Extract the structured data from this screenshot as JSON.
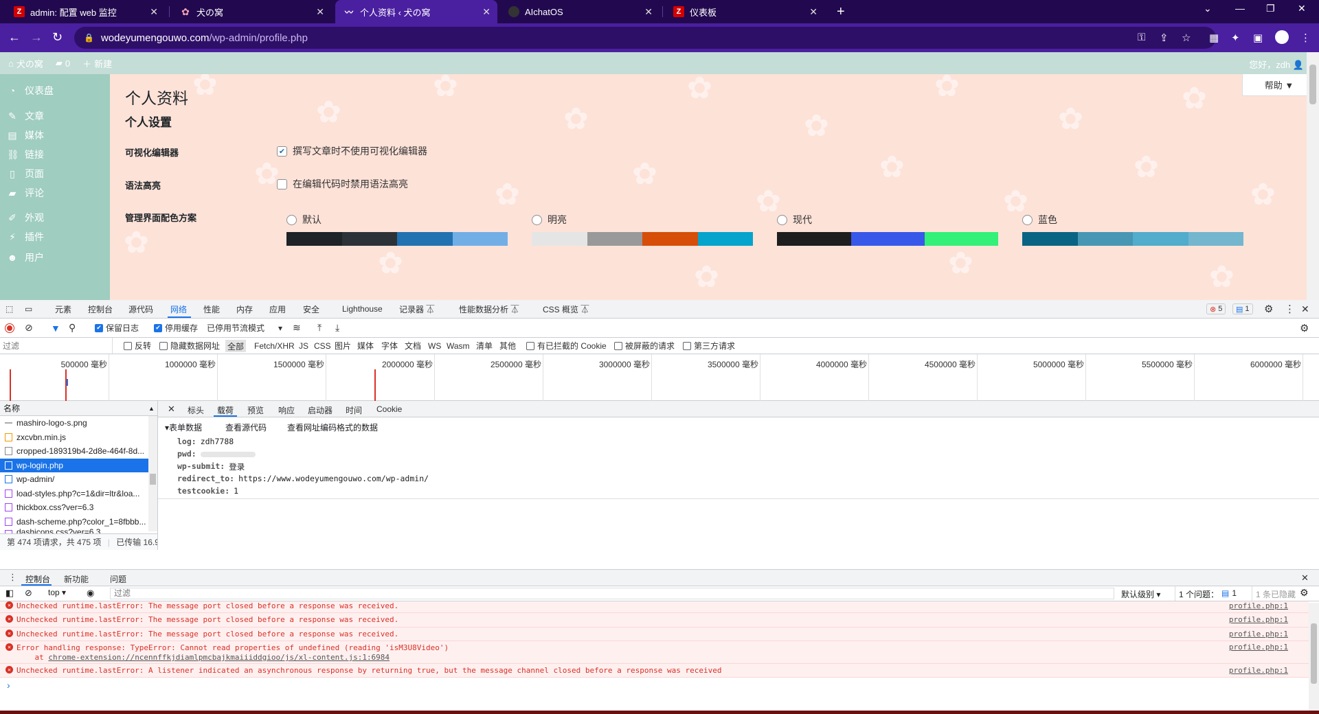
{
  "browser": {
    "tabs": [
      {
        "label": "admin: 配置 web 监控",
        "fav": "Z",
        "fav_color": "#d40000"
      },
      {
        "label": "犬の窝",
        "fav": "✿",
        "fav_color": "#f4a6b6"
      },
      {
        "label": "个人资料 ‹ 犬の窝",
        "fav": "〰",
        "fav_color": "#ffffff",
        "active": true
      },
      {
        "label": "AIchatOS",
        "fav": "◉",
        "fav_color": "#222222"
      },
      {
        "label": "仪表板",
        "fav": "Z",
        "fav_color": "#d40000"
      }
    ],
    "url_host": "wodeyumengouwo.com",
    "url_path": "/wp-admin/profile.php"
  },
  "wp": {
    "site_name": "犬の窝",
    "comments_count": "0",
    "new_label": "新建",
    "greeting": "您好，zdh",
    "help_label": "帮助 ▼",
    "menu": [
      "仪表盘",
      "文章",
      "媒体",
      "链接",
      "页面",
      "评论",
      "外观",
      "插件",
      "用户"
    ],
    "page_title": "个人资料",
    "section_title": "个人设置",
    "visual_editor_label": "可视化编辑器",
    "visual_editor_option": "撰写文章时不使用可视化编辑器",
    "syntax_label": "语法高亮",
    "syntax_option": "在编辑代码时禁用语法高亮",
    "scheme_label": "管理界面配色方案",
    "schemes": [
      {
        "name": "默认",
        "colors": [
          "#1d2327",
          "#2c3338",
          "#2271b1",
          "#72aee6"
        ]
      },
      {
        "name": "明亮",
        "colors": [
          "#e5e5e5",
          "#999999",
          "#d64e07",
          "#04a4cc"
        ]
      },
      {
        "name": "现代",
        "colors": [
          "#1e1e1e",
          "#3858e9",
          "#33f078"
        ]
      },
      {
        "name": "蓝色",
        "colors": [
          "#096484",
          "#4796b3",
          "#52accc",
          "#74b6ce"
        ]
      }
    ]
  },
  "devtools": {
    "panels": [
      "元素",
      "控制台",
      "源代码",
      "网络",
      "性能",
      "内存",
      "应用",
      "安全",
      "Lighthouse",
      "记录器 ⏄",
      "性能数据分析 ⏄",
      "CSS 概览 ⏄"
    ],
    "error_count": "5",
    "message_count": "1",
    "preserve_log": "保留日志",
    "disable_cache": "停用缓存",
    "throttle": "已停用节流模式",
    "filter_placeholder": "过滤",
    "invert": "反转",
    "hide_data_urls": "隐藏数据网址",
    "type_filters": [
      "全部",
      "Fetch/XHR",
      "JS",
      "CSS",
      "图片",
      "媒体",
      "字体",
      "文档",
      "WS",
      "Wasm",
      "清单",
      "其他"
    ],
    "blocked_cookies": "有已拦截的 Cookie",
    "blocked_requests": "被屏蔽的请求",
    "third_party": "第三方请求",
    "timeline_ticks": [
      "500000 毫秒",
      "1000000 毫秒",
      "1500000 毫秒",
      "2000000 毫秒",
      "2500000 毫秒",
      "3000000 毫秒",
      "3500000 毫秒",
      "4000000 毫秒",
      "4500000 毫秒",
      "5000000 毫秒",
      "5500000 毫秒",
      "6000000 毫秒"
    ],
    "name_header": "名称",
    "requests": [
      {
        "name": "mashiro-logo-s.png",
        "icon": "#aaaaaa"
      },
      {
        "name": "zxcvbn.min.js",
        "icon": "#f29900"
      },
      {
        "name": "cropped-189319b4-2d8e-464f-8d...",
        "icon": "#888888"
      },
      {
        "name": "wp-login.php",
        "icon": "#ffffff",
        "selected": true
      },
      {
        "name": "wp-admin/",
        "icon": "#1a73e8"
      },
      {
        "name": "load-styles.php?c=1&dir=ltr&loa...",
        "icon": "#a142f4"
      },
      {
        "name": "thickbox.css?ver=6.3",
        "icon": "#a142f4"
      },
      {
        "name": "dash-scheme.php?color_1=8fbbb...",
        "icon": "#a142f4"
      },
      {
        "name": "dashicons.css?ver=6.3",
        "icon": "#a142f4"
      }
    ],
    "footer_count": "第 474 项请求，共 475 项",
    "footer_transferred": "已传输 16.9",
    "detail_tabs": [
      "标头",
      "载荷",
      "预览",
      "响应",
      "启动器",
      "时间",
      "Cookie"
    ],
    "form_data_title": "▾表单数据",
    "view_source": "查看源代码",
    "view_url_encoded": "查看网址编码格式的数据",
    "form_fields": [
      {
        "key": "log:",
        "value": "zdh7788"
      },
      {
        "key": "pwd:",
        "value": ""
      },
      {
        "key": "wp-submit:",
        "value": "登录"
      },
      {
        "key": "redirect_to:",
        "value": "https://www.wodeyumengouwo.com/wp-admin/"
      },
      {
        "key": "testcookie:",
        "value": "1"
      }
    ],
    "drawer_tabs": [
      "控制台",
      "新功能",
      "问题"
    ],
    "context": "top ▾",
    "console_filter": "过滤",
    "default_levels": "默认级别 ▾",
    "issues": "1 个问题：",
    "issues_count": "1",
    "hidden": "1 条已隐藏",
    "console_messages": [
      {
        "text": "Unchecked runtime.lastError: The message port closed before a response was received.",
        "src": "profile.php:1"
      },
      {
        "text": "Unchecked runtime.lastError: The message port closed before a response was received.",
        "src": "profile.php:1"
      },
      {
        "text": "Unchecked runtime.lastError: The message port closed before a response was received.",
        "src": "profile.php:1"
      },
      {
        "text": "Error handling response: TypeError: Cannot read properties of undefined (reading 'isM3U8Video')",
        "src": "profile.php:1",
        "trace_prefix": "    at ",
        "trace_link": "chrome-extension://ncennffkjdiamlpmcbajkmaiiiddgioo/js/xl-content.js:1:6984"
      },
      {
        "text": "Unchecked runtime.lastError: A listener indicated an asynchronous response by returning true, but the message channel closed before a response was received",
        "src": "profile.php:1"
      }
    ],
    "prompt": "›"
  }
}
